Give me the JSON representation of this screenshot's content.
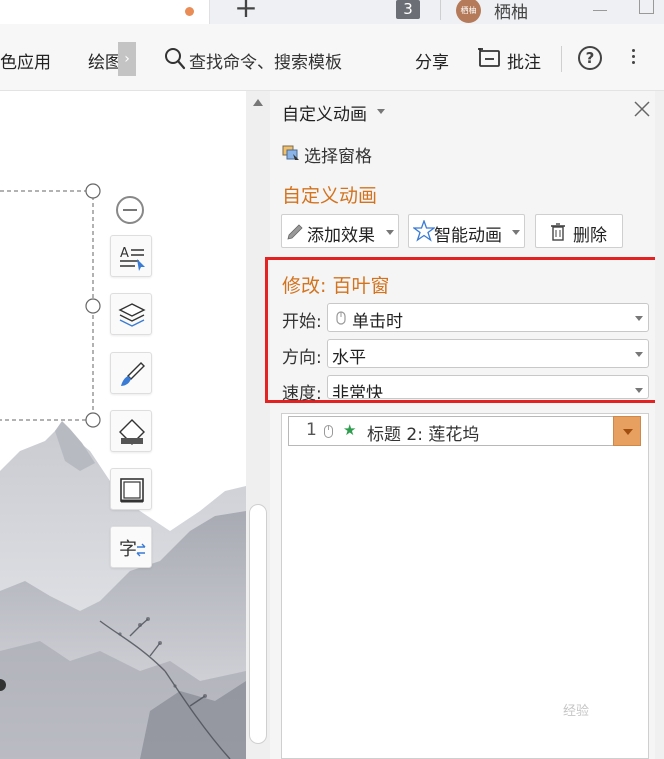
{
  "titlebar": {
    "window_count": "3",
    "avatar_text": "栖柚",
    "username": "栖柚"
  },
  "toolbar": {
    "color_apps": "色应用",
    "draw": "绘图",
    "scroll_arrow": "›",
    "search_placeholder": "查找命令、搜索模板",
    "share": "分享",
    "comment": "批注",
    "help": "?"
  },
  "pane": {
    "title": "自定义动画",
    "select_pane": "选择窗格",
    "section_title": "自定义动画",
    "buttons": {
      "add_effect": "添加效果",
      "smart_animation": "智能动画",
      "delete": "删除"
    },
    "modify": {
      "title": "修改: 百叶窗",
      "start_label": "开始:",
      "start_value": "单击时",
      "direction_label": "方向:",
      "direction_value": "水平",
      "speed_label": "速度:",
      "speed_value": "非常快"
    },
    "animation_list": [
      {
        "number": "1",
        "label": "标题 2: 莲花坞"
      }
    ]
  },
  "colors": {
    "accent_orange": "#d3731e",
    "highlight_red": "#e42222",
    "list_dropdown": "#e8a060",
    "star_green": "#2e9d4d"
  },
  "icons": [
    "plus-icon",
    "search-icon",
    "comment-icon",
    "help-icon",
    "more-icon",
    "close-icon",
    "select-pane-icon",
    "pen-icon",
    "star-icon",
    "trash-icon",
    "mouse-icon",
    "minus-icon",
    "text-style-icon",
    "layers-icon",
    "brush-icon",
    "fill-icon",
    "frame-icon",
    "text-convert-icon"
  ],
  "watermark": "经验"
}
